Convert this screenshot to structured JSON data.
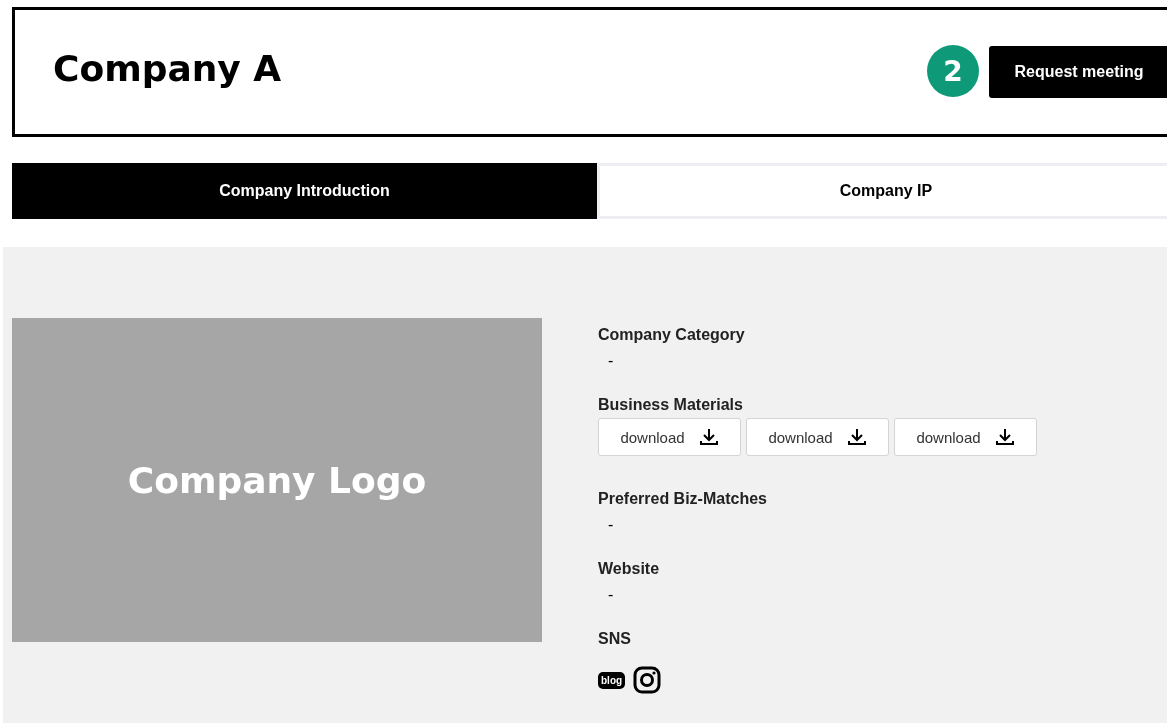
{
  "header": {
    "title": "Company A",
    "step_badge": "2",
    "action": "Request meeting"
  },
  "tabs": [
    {
      "label": "Company Introduction",
      "selected": true
    },
    {
      "label": "Company IP",
      "selected": false
    }
  ],
  "logo": {
    "label": "Company Logo"
  },
  "fields": [
    {
      "kind": "text",
      "label": "Company Category",
      "value": "-"
    },
    {
      "kind": "downloads",
      "label": "Business Materials",
      "buttons": [
        "download",
        "download",
        "download"
      ]
    },
    {
      "kind": "text",
      "label": "Preferred Biz-Matches",
      "value": "-"
    },
    {
      "kind": "text",
      "label": "Website",
      "value": "-"
    },
    {
      "kind": "sns",
      "label": "SNS",
      "links": [
        {
          "kind": "blog",
          "text": "blog"
        },
        {
          "kind": "instagram"
        }
      ]
    }
  ]
}
